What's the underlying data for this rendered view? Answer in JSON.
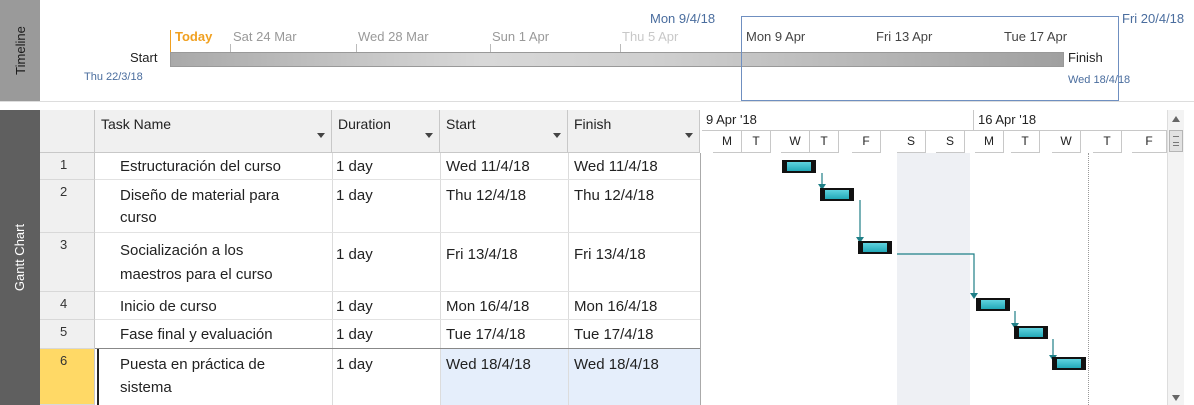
{
  "side_labels": {
    "timeline": "Timeline",
    "gantt": "Gantt Chart"
  },
  "timeline": {
    "today": "Today",
    "dates": [
      "Sat 24 Mar",
      "Wed 28 Mar",
      "Sun 1 Apr",
      "Thu 5 Apr",
      "Mon 9 Apr",
      "Fri 13 Apr",
      "Tue 17 Apr"
    ],
    "start_label": "Start",
    "start_date": "Thu 22/3/18",
    "finish_label": "Finish",
    "finish_date": "Wed 18/4/18",
    "range_start": "Mon 9/4/18",
    "range_end": "Fri 20/4/18"
  },
  "table": {
    "headers": {
      "task_name": "Task Name",
      "duration": "Duration",
      "start": "Start",
      "finish": "Finish"
    },
    "rows": [
      {
        "id": "1",
        "name_line1": "Estructuración del curso",
        "name_line2": "",
        "duration": "1 day",
        "start": "Wed 11/4/18",
        "finish": "Wed 11/4/18"
      },
      {
        "id": "2",
        "name_line1": "Diseño de material para",
        "name_line2": "curso",
        "duration": "1 day",
        "start": "Thu 12/4/18",
        "finish": "Thu 12/4/18"
      },
      {
        "id": "3",
        "name_line1": "Socialización a los",
        "name_line2": "maestros para el curso",
        "duration": "1 day",
        "start": "Fri 13/4/18",
        "finish": "Fri 13/4/18"
      },
      {
        "id": "4",
        "name_line1": "Inicio de curso",
        "name_line2": "",
        "duration": "1 day",
        "start": "Mon 16/4/18",
        "finish": "Mon 16/4/18"
      },
      {
        "id": "5",
        "name_line1": "Fase final y evaluación",
        "name_line2": "",
        "duration": "1 day",
        "start": "Tue 17/4/18",
        "finish": "Tue 17/4/18"
      },
      {
        "id": "6",
        "name_line1": "Puesta en práctica de",
        "name_line2": "sistema",
        "duration": "1 day",
        "start": "Wed 18/4/18",
        "finish": "Wed 18/4/18"
      }
    ]
  },
  "chart": {
    "week1": "9 Apr '18",
    "week2": "16 Apr '18",
    "days": [
      "M",
      "T",
      "W",
      "T",
      "F",
      "S",
      "S",
      "M",
      "T",
      "W",
      "T",
      "F"
    ],
    "bar_color": "#23a9b8"
  }
}
